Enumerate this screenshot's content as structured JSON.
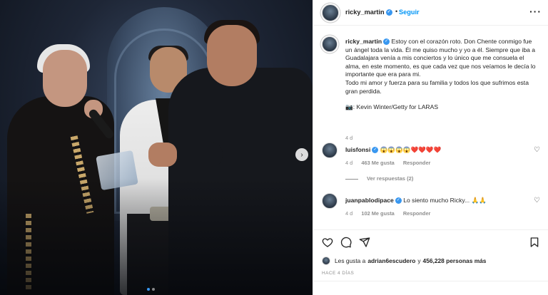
{
  "photo": {
    "alt_credit": "Kevin Winter/Getty for LARAS"
  },
  "header": {
    "username": "ricky_martin",
    "separator": "•",
    "follow_label": "Seguir",
    "more_label": "···"
  },
  "caption": {
    "username": "ricky_martin",
    "line1": "Estoy con el corazón roto. Don Chente conmigo fue un ángel toda la vida. Él me quiso mucho y yo a él. Siempre que iba a Guadalajara venía a mis conciertos y lo único que me consuela el alma, en este momento, es que cada vez que nos veíamos le decía lo importante que era para mi.",
    "line2": "Todo mi amor y fuerza para su familia y todos los que sufrimos esta gran perdida.",
    "credit": "📷: Kevin Winter/Getty for LARAS",
    "time": "4 d"
  },
  "comments": [
    {
      "username": "luisfonsi",
      "text": "😱😱😱😱❤️❤️❤️❤️",
      "time": "4 d",
      "likes": "463 Me gusta",
      "reply": "Responder",
      "view_replies": "Ver respuestas (2)"
    },
    {
      "username": "juanpablodipace",
      "text": "Lo siento mucho Ricky... 🙏🙏",
      "time": "4 d",
      "likes": "102 Me gusta",
      "reply": "Responder"
    }
  ],
  "likes": {
    "prefix": "Les gusta a",
    "user": "adrian6escudero",
    "conj": "y",
    "count": "456,228 personas más"
  },
  "time_ago": "HACE 4 DÍAS",
  "colors": {
    "accent": "#0095f6",
    "verified": "#3897f0",
    "heart": "#ed4956"
  },
  "icons": [
    "heart-icon",
    "comment-icon",
    "share-icon",
    "bookmark-icon",
    "more-icon",
    "verified-icon",
    "next-arrow-icon"
  ]
}
